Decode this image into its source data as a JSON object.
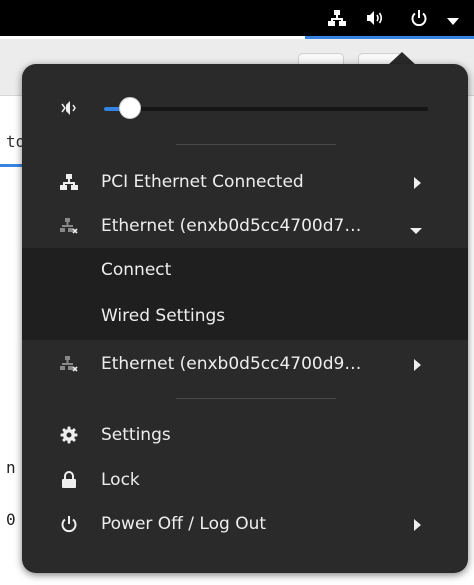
{
  "top_bar": {
    "icons": [
      "network-wired-icon",
      "audio-volume-icon",
      "power-icon",
      "chevron-down-icon"
    ]
  },
  "background": {
    "tab_text": "to",
    "text_line_1": "n",
    "text_line_2": "0"
  },
  "menu": {
    "volume": {
      "icon": "audio-volume-muted-icon",
      "level": 0.08
    },
    "network_items": [
      {
        "label": "PCI Ethernet Connected",
        "icon": "network-wired-icon",
        "chevron": "right"
      },
      {
        "label": "Ethernet (enxb0d5cc4700d7…",
        "icon": "network-wired-disconnected-icon",
        "chevron": "down"
      },
      {
        "label": "Ethernet (enxb0d5cc4700d9…",
        "icon": "network-wired-disconnected-icon",
        "chevron": "right"
      }
    ],
    "submenu": {
      "connect_label": "Connect",
      "wired_settings_label": "Wired Settings"
    },
    "settings_label": "Settings",
    "lock_label": "Lock",
    "power_off_label": "Power Off / Log Out"
  },
  "colors": {
    "accent": "#3584e4",
    "menu_bg": "#2a2a2a",
    "submenu_bg": "#1f1f1f"
  }
}
